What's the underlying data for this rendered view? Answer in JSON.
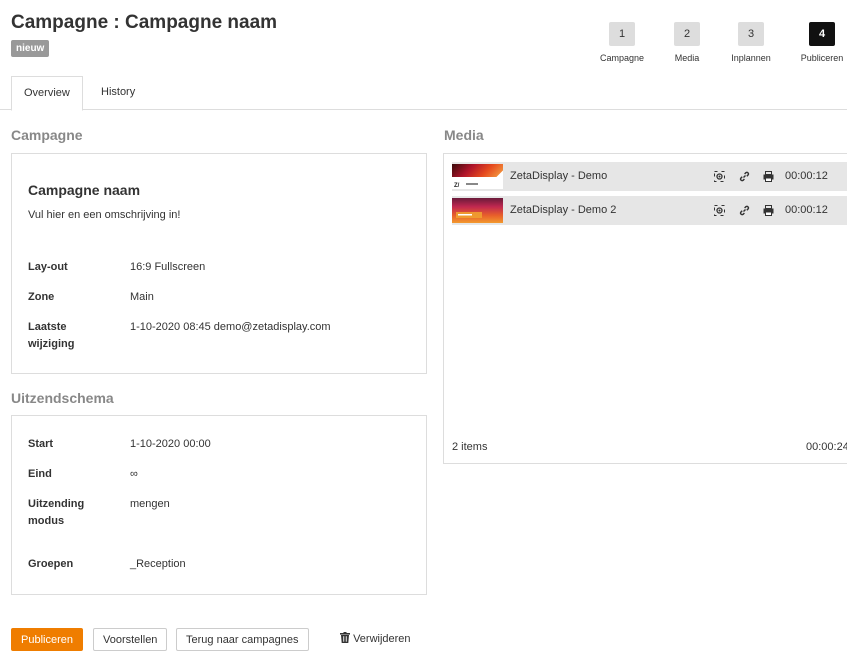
{
  "header": {
    "title": "Campagne : Campagne naam",
    "status_badge": "nieuw"
  },
  "steps": [
    {
      "number": "1",
      "label": "Campagne",
      "active": false
    },
    {
      "number": "2",
      "label": "Media",
      "active": false
    },
    {
      "number": "3",
      "label": "Inplannen",
      "active": false
    },
    {
      "number": "4",
      "label": "Publiceren",
      "active": true
    }
  ],
  "tabs": [
    {
      "label": "Overview",
      "active": true
    },
    {
      "label": "History",
      "active": false
    }
  ],
  "campaign": {
    "section_title": "Campagne",
    "name": "Campagne naam",
    "description": "Vul hier en een omschrijving in!",
    "fields": [
      {
        "label": "Lay-out",
        "value": "16:9 Fullscreen"
      },
      {
        "label": "Zone",
        "value": "Main"
      },
      {
        "label": "Laatste wijziging",
        "value": "1-10-2020 08:45 demo@zetadisplay.com"
      }
    ]
  },
  "schedule": {
    "section_title": "Uitzendschema",
    "fields": [
      {
        "label": "Start",
        "value": "1-10-2020 00:00"
      },
      {
        "label": "Eind",
        "value": "∞"
      },
      {
        "label": "Uitzending modus",
        "value": "mengen"
      },
      {
        "label": "Groepen",
        "value": "_Reception"
      }
    ]
  },
  "media": {
    "section_title": "Media",
    "items": [
      {
        "name": "ZetaDisplay - Demo",
        "duration": "00:00:12",
        "icons": [
          "preview-icon",
          "link-icon",
          "print-icon"
        ]
      },
      {
        "name": "ZetaDisplay - Demo 2",
        "duration": "00:00:12",
        "icons": [
          "preview-icon",
          "link-icon",
          "print-icon"
        ]
      }
    ],
    "footer_count": "2 items",
    "footer_total": "00:00:24"
  },
  "actions": {
    "publish": "Publiceren",
    "propose": "Voorstellen",
    "back": "Terug naar campagnes",
    "delete": "Verwijderen"
  },
  "colors": {
    "accent": "#ef7d00",
    "active_step": "#111111",
    "badge": "#999999"
  }
}
